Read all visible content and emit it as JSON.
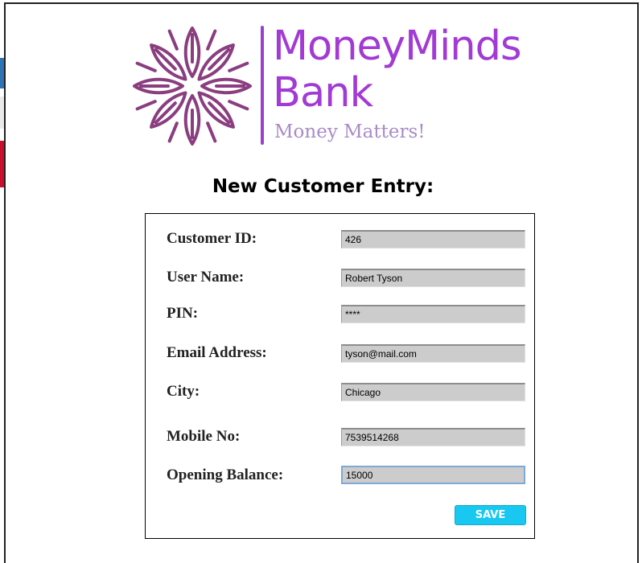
{
  "brand": {
    "name_line1": "MoneyMinds",
    "name_line2": "Bank",
    "tagline": "Money Matters!",
    "colors": {
      "primary": "#a23ad4",
      "mark": "#8a3e80",
      "tagline": "#a98bc8"
    }
  },
  "form": {
    "title": "New Customer Entry:",
    "fields": [
      {
        "label": "Customer ID:",
        "value": "426"
      },
      {
        "label": "User Name:",
        "value": "Robert Tyson"
      },
      {
        "label": "PIN:",
        "value": "****"
      },
      {
        "label": "Email Address:",
        "value": "tyson@mail.com"
      },
      {
        "label": "City:",
        "value": "Chicago"
      },
      {
        "label": "Mobile No:",
        "value": "7539514268"
      },
      {
        "label": "Opening Balance:",
        "value": "15000"
      }
    ],
    "save_label": "SAVE",
    "save_color": "#18c8f0"
  }
}
